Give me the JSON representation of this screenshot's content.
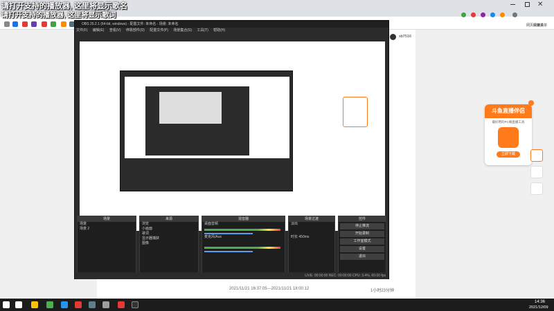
{
  "lyrics": {
    "line1": "请打开支持的播放器, 这里将显示歌名",
    "line2": "请打开支持的播放器, 这里将显示歌词"
  },
  "browser": {
    "address_fragment": "3/index",
    "profile_name": "xb7516",
    "reading_mode": "阅读清单",
    "net_disk": "网页收藏夹"
  },
  "obs": {
    "title": "OBS 25.2.1 (64-bit, windows) - 配置文件: 未命名 - 场景: 未命名",
    "menu": [
      "文件(F)",
      "编辑(E)",
      "查看(V)",
      "停靠部件(D)",
      "配置文件(P)",
      "场景集合(S)",
      "工具(T)",
      "帮助(H)"
    ],
    "panels": {
      "scenes": {
        "title": "场景",
        "items": [
          "场景",
          "场景 2"
        ]
      },
      "sources": {
        "title": "来源",
        "items": [
          "浏览",
          "小画面",
          "歌词",
          "显示器捕获",
          "图像"
        ]
      },
      "mixer": {
        "title": "混音器",
        "tracks": [
          "桌面音频",
          "麦克风/Aux"
        ]
      },
      "transitions": {
        "title": "场景过渡",
        "type": "淡出",
        "duration_label": "时长",
        "duration": "450ms"
      },
      "controls": {
        "title": "控件",
        "buttons": [
          "停止推流",
          "开始录制",
          "工作室模式",
          "设置",
          "退出"
        ]
      }
    },
    "status": "LIVE: 00:00:00  REC: 00:00:00  CPU: 3.4%, 60.00 fps"
  },
  "widget": {
    "title": "斗鱼直播伴侣",
    "subtitle": "最好用的PC端直播工具",
    "button": "立即下载"
  },
  "footer": {
    "time_range": "2021/11/21 16:37:05---2021/11/21 18:00:12",
    "duration": "1小时23分钟"
  },
  "taskbar": {
    "time": "14:36",
    "date": "2021/12/09"
  }
}
